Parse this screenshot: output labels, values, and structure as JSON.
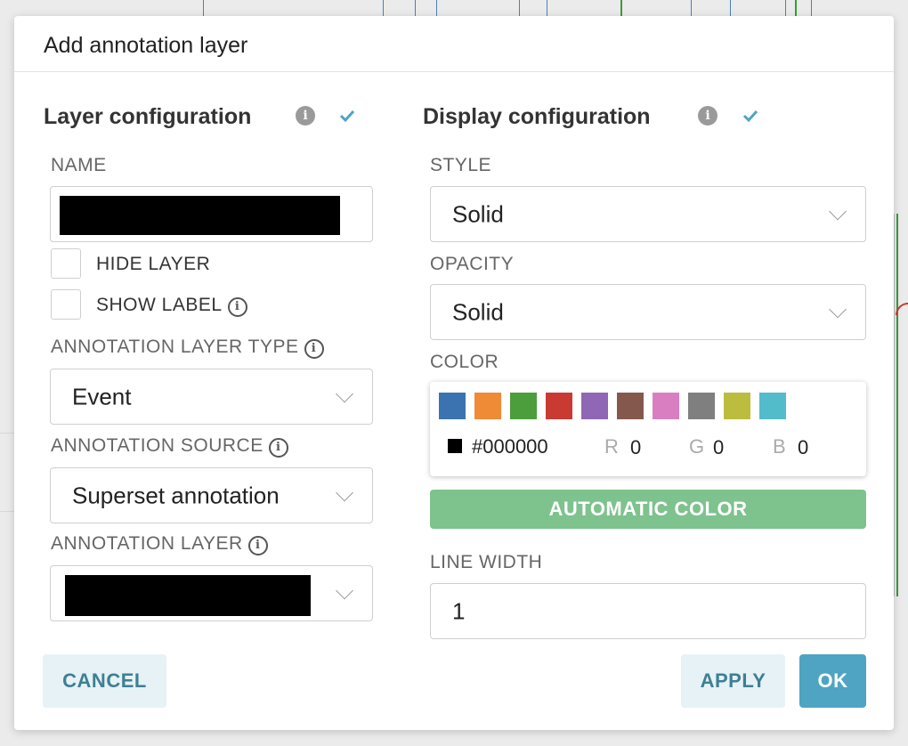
{
  "dialog": {
    "title": "Add annotation layer"
  },
  "layer_config": {
    "title": "Layer configuration",
    "name_label": "NAME",
    "name_value": "",
    "hide_layer_label": "HIDE LAYER",
    "show_label_label": "SHOW LABEL",
    "type_label": "ANNOTATION LAYER TYPE",
    "type_value": "Event",
    "source_label": "ANNOTATION SOURCE",
    "source_value": "Superset annotation",
    "layer_label": "ANNOTATION LAYER",
    "layer_value": ""
  },
  "display_config": {
    "title": "Display configuration",
    "style_label": "STYLE",
    "style_value": "Solid",
    "opacity_label": "OPACITY",
    "opacity_value": "Solid",
    "color_label": "COLOR",
    "swatches": [
      "#3b73b0",
      "#ef8a36",
      "#4b9e3b",
      "#c93a33",
      "#9066b7",
      "#85584e",
      "#d97fc1",
      "#7f7f7f",
      "#bcbc3f",
      "#53bccb"
    ],
    "hex_value": "#000000",
    "r_label": "R",
    "r_value": "0",
    "g_label": "G",
    "g_value": "0",
    "b_label": "B",
    "b_value": "0",
    "auto_color_label": "AUTOMATIC COLOR",
    "line_width_label": "LINE WIDTH",
    "line_width_value": "1"
  },
  "buttons": {
    "cancel": "CANCEL",
    "apply": "APPLY",
    "ok": "OK"
  },
  "info_glyph": "i",
  "colors": {
    "accent": "#4ea4c2",
    "auto_color_bg": "#7ec28e",
    "check": "#4ea4c2"
  }
}
